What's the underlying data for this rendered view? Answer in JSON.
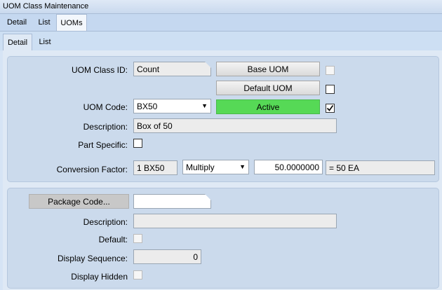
{
  "window": {
    "title": "UOM Class Maintenance"
  },
  "tabs_top": [
    "Detail",
    "List",
    "UOMs"
  ],
  "tabs_sub": [
    "Detail",
    "List"
  ],
  "form": {
    "uom_class_id": {
      "label": "UOM Class ID:",
      "value": "Count"
    },
    "base_uom_button": "Base UOM",
    "default_uom_button": "Default UOM",
    "uom_code": {
      "label": "UOM Code:",
      "value": "BX50"
    },
    "active_button": "Active",
    "description": {
      "label": "Description:",
      "value": "Box of 50"
    },
    "part_specific": {
      "label": "Part Specific:"
    },
    "conversion_factor": {
      "label": "Conversion Factor:",
      "from": "1 BX50",
      "operator": "Multiply",
      "value": "50.0000000",
      "result": "= 50 EA"
    }
  },
  "package": {
    "package_code_button": "Package Code...",
    "package_code_value": "",
    "description_label": "Description:",
    "description_value": "",
    "default_label": "Default:",
    "display_sequence_label": "Display Sequence:",
    "display_sequence_value": "0",
    "display_hidden_label": "Display Hidden"
  },
  "colors": {
    "active_status": "#56d956",
    "panel_bg": "#cbdaec",
    "window_bg": "#d6e4f5"
  }
}
